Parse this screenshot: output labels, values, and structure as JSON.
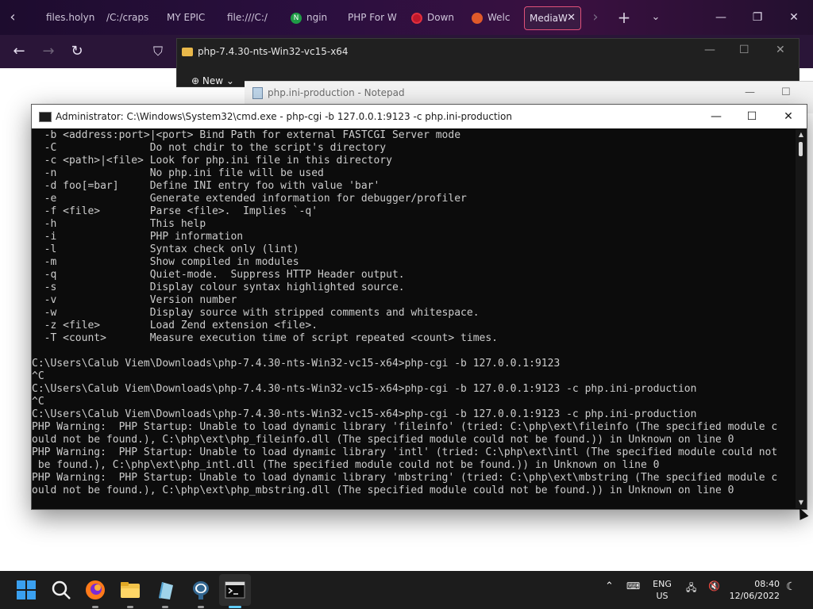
{
  "browser": {
    "tabs": [
      {
        "label": "files.holyn",
        "favicon": "page-icon"
      },
      {
        "label": "/C:/craps",
        "favicon": "page-icon"
      },
      {
        "label": "MY EPIC",
        "favicon": "page-icon"
      },
      {
        "label": "file:///C:/",
        "favicon": "page-icon"
      },
      {
        "label": "ngin",
        "favicon": "nginx-icon"
      },
      {
        "label": "PHP For W",
        "favicon": "page-icon"
      },
      {
        "label": "Down",
        "favicon": "opera-icon"
      },
      {
        "label": "Welc",
        "favicon": "mascot-icon"
      },
      {
        "label": "MediaW",
        "favicon": "page-icon",
        "active": true
      }
    ]
  },
  "explorer": {
    "title": "php-7.4.30-nts-Win32-vc15-x64",
    "new_label": "New"
  },
  "notepad": {
    "title": "php.ini-production - Notepad"
  },
  "cmd": {
    "title": "Administrator: C:\\Windows\\System32\\cmd.exe - php-cgi  -b 127.0.0.1:9123 -c php.ini-production",
    "lines": [
      "  -b <address:port>|<port> Bind Path for external FASTCGI Server mode",
      "  -C               Do not chdir to the script's directory",
      "  -c <path>|<file> Look for php.ini file in this directory",
      "  -n               No php.ini file will be used",
      "  -d foo[=bar]     Define INI entry foo with value 'bar'",
      "  -e               Generate extended information for debugger/profiler",
      "  -f <file>        Parse <file>.  Implies `-q'",
      "  -h               This help",
      "  -i               PHP information",
      "  -l               Syntax check only (lint)",
      "  -m               Show compiled in modules",
      "  -q               Quiet-mode.  Suppress HTTP Header output.",
      "  -s               Display colour syntax highlighted source.",
      "  -v               Version number",
      "  -w               Display source with stripped comments and whitespace.",
      "  -z <file>        Load Zend extension <file>.",
      "  -T <count>       Measure execution time of script repeated <count> times.",
      "",
      "C:\\Users\\Calub Viem\\Downloads\\php-7.4.30-nts-Win32-vc15-x64>php-cgi -b 127.0.0.1:9123",
      "^C",
      "C:\\Users\\Calub Viem\\Downloads\\php-7.4.30-nts-Win32-vc15-x64>php-cgi -b 127.0.0.1:9123 -c php.ini-production",
      "^C",
      "C:\\Users\\Calub Viem\\Downloads\\php-7.4.30-nts-Win32-vc15-x64>php-cgi -b 127.0.0.1:9123 -c php.ini-production",
      "PHP Warning:  PHP Startup: Unable to load dynamic library 'fileinfo' (tried: C:\\php\\ext\\fileinfo (The specified module c",
      "ould not be found.), C:\\php\\ext\\php_fileinfo.dll (The specified module could not be found.)) in Unknown on line 0",
      "PHP Warning:  PHP Startup: Unable to load dynamic library 'intl' (tried: C:\\php\\ext\\intl (The specified module could not",
      " be found.), C:\\php\\ext\\php_intl.dll (The specified module could not be found.)) in Unknown on line 0",
      "PHP Warning:  PHP Startup: Unable to load dynamic library 'mbstring' (tried: C:\\php\\ext\\mbstring (The specified module c",
      "ould not be found.), C:\\php\\ext\\php_mbstring.dll (The specified module could not be found.)) in Unknown on line 0"
    ]
  },
  "taskbar": {
    "apps": [
      "windows-start-icon",
      "search-icon",
      "firefox-icon",
      "file-explorer-icon",
      "notepad-icon",
      "postgres-icon",
      "terminal-icon"
    ],
    "language": "ENG",
    "region": "US",
    "time": "08:40",
    "date": "12/06/2022"
  }
}
